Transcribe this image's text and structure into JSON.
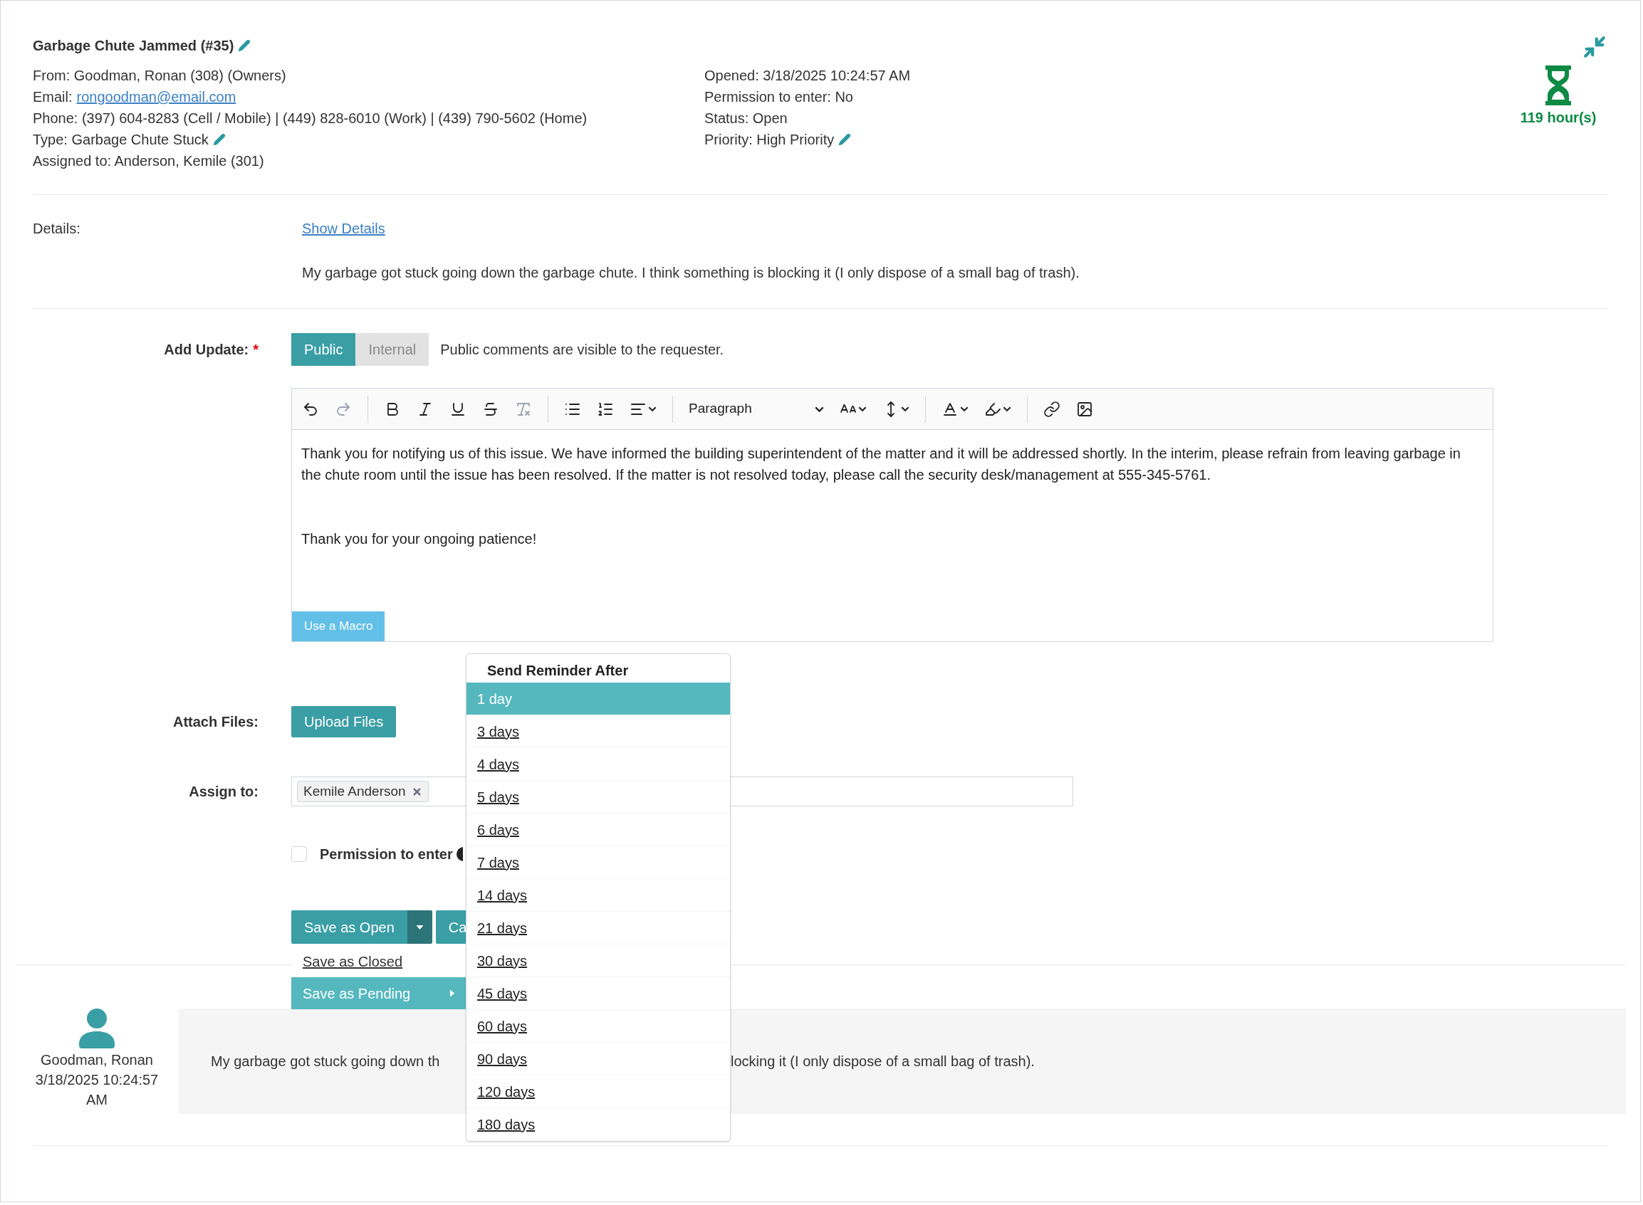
{
  "ticket": {
    "title": "Garbage Chute Jammed (#35)",
    "title_editable": true,
    "left_lines": [
      {
        "kind": "text",
        "text": "From: Goodman, Ronan (308) (Owners)",
        "editable": false
      },
      {
        "kind": "link",
        "label": "Email:",
        "text": "rongoodman@email.com",
        "editable": false
      },
      {
        "kind": "text",
        "text": "Phone: (397) 604-8283 (Cell / Mobile) | (449) 828-6010 (Work) | (439) 790-5602 (Home)",
        "editable": false
      },
      {
        "kind": "text",
        "text": "Type: Garbage Chute Stuck",
        "editable": true
      },
      {
        "kind": "text",
        "text": "Assigned to: Anderson, Kemile (301)",
        "editable": false
      }
    ],
    "right_lines": [
      {
        "text": "Opened: 3/18/2025 10:24:57 AM",
        "editable": false
      },
      {
        "text": "Permission to enter: No",
        "editable": false
      },
      {
        "text": "Status: Open",
        "editable": false
      },
      {
        "text": "Priority: High Priority",
        "editable": true
      }
    ]
  },
  "timer": {
    "text": "119 hour(s)"
  },
  "details": {
    "label": "Details:",
    "link": "Show Details",
    "text": "My garbage got stuck going down the garbage chute. I think something is blocking it (I only dispose of a small bag of trash)."
  },
  "update": {
    "label": "Add Update:",
    "required": true,
    "required_mark": "*",
    "visibility": [
      {
        "label": "Public",
        "selected": true
      },
      {
        "label": "Internal",
        "selected": false
      }
    ],
    "hint": "Public comments are visible to the requester.",
    "editor": {
      "format": "Paragraph",
      "paragraphs": [
        "Thank you for notifying us of this issue. We have informed the building superintendent of the matter and it will be addressed shortly. In the interim, please refrain from leaving garbage in the chute room until the issue has been resolved. If the matter is not resolved today, please call the security desk/management at 555-345-5761.",
        "Thank you for your ongoing patience!"
      ],
      "macro_button": "Use a Macro"
    }
  },
  "attach": {
    "label": "Attach Files:",
    "button": "Upload Files"
  },
  "assign": {
    "label": "Assign to:",
    "chips": [
      "Kemile Anderson"
    ]
  },
  "permission": {
    "label": "Permission to enter",
    "checked": false
  },
  "save": {
    "primary": "Save as Open",
    "secondary": "Ca",
    "menu": [
      {
        "label": "Save as Closed",
        "selected": false,
        "submenu": false
      },
      {
        "label": "Save as Pending",
        "selected": true,
        "submenu": true
      }
    ]
  },
  "reminder_menu": {
    "title": "Send Reminder After",
    "options": [
      {
        "label": "1 day",
        "selected": true
      },
      {
        "label": "3 days",
        "selected": false
      },
      {
        "label": "4 days",
        "selected": false
      },
      {
        "label": "5 days",
        "selected": false
      },
      {
        "label": "6 days",
        "selected": false
      },
      {
        "label": "7 days",
        "selected": false
      },
      {
        "label": "14 days",
        "selected": false
      },
      {
        "label": "21 days",
        "selected": false
      },
      {
        "label": "30 days",
        "selected": false
      },
      {
        "label": "45 days",
        "selected": false
      },
      {
        "label": "60 days",
        "selected": false
      },
      {
        "label": "90 days",
        "selected": false
      },
      {
        "label": "120 days",
        "selected": false
      },
      {
        "label": "180 days",
        "selected": false
      }
    ]
  },
  "comments": [
    {
      "author": "Goodman, Ronan",
      "time": "3/18/2025 10:24:57 AM",
      "text_parts": [
        "My garbage got stuck going down th",
        "locking it (I only dispose of a small bag of trash)."
      ]
    }
  ]
}
